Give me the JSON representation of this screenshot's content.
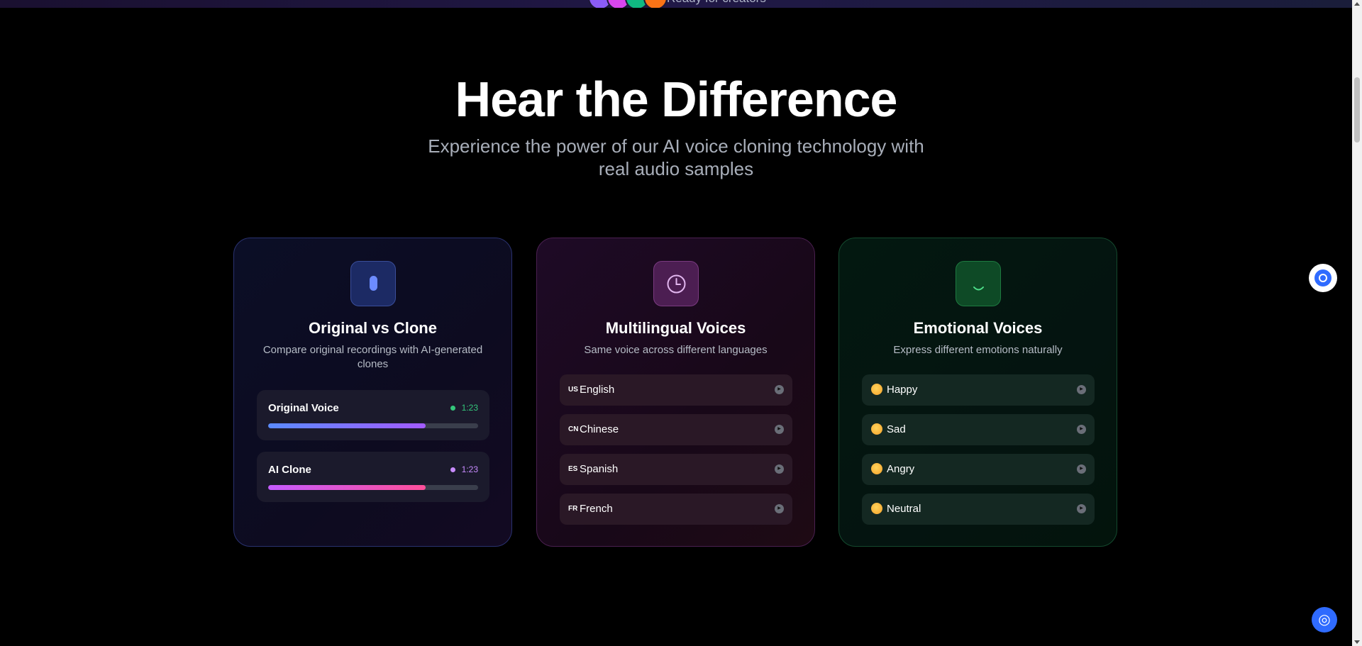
{
  "colors": {
    "background": "#000000",
    "accent_blue": "#2f6bff",
    "original_voice_gradient": [
      "#5a8bff",
      "#a35bff"
    ],
    "ai_clone_gradient": [
      "#c45bff",
      "#ff4f9a"
    ],
    "time_green": "#34c77b",
    "time_purple": "#c88bff"
  },
  "top_banner": {
    "avatar_colors": [
      "#8b5cf6",
      "#d946ef",
      "#10b981",
      "#f97316"
    ],
    "tagline": "Ready for creators"
  },
  "hero": {
    "title": "Hear the Difference",
    "subtitle": "Experience the power of our AI voice cloning technology with real audio samples"
  },
  "cards": {
    "original": {
      "icon": "microphone-icon",
      "title": "Original vs Clone",
      "description": "Compare original recordings with AI-generated clones",
      "players": [
        {
          "label": "Original Voice",
          "time": "1:23",
          "progress": 0.75,
          "dot_color": "#34c77b"
        },
        {
          "label": "AI Clone",
          "time": "1:23",
          "progress": 0.75,
          "dot_color": "#c88bff"
        }
      ]
    },
    "multilingual": {
      "icon": "clock-icon",
      "title": "Multilingual Voices",
      "description": "Same voice across different languages",
      "languages": [
        {
          "flag": "US",
          "label": "English"
        },
        {
          "flag": "CN",
          "label": "Chinese"
        },
        {
          "flag": "ES",
          "label": "Spanish"
        },
        {
          "flag": "FR",
          "label": "French"
        }
      ]
    },
    "emotional": {
      "icon": "smile-icon",
      "title": "Emotional Voices",
      "description": "Express different emotions naturally",
      "emotions": [
        {
          "emoji": "happy-face-icon",
          "label": "Happy"
        },
        {
          "emoji": "sad-face-icon",
          "label": "Sad"
        },
        {
          "emoji": "angry-face-icon",
          "label": "Angry"
        },
        {
          "emoji": "neutral-face-icon",
          "label": "Neutral"
        }
      ]
    }
  },
  "widgets": {
    "chat_widget_icon": "chat-widget-icon",
    "help_button_icon": "target-help-icon"
  }
}
